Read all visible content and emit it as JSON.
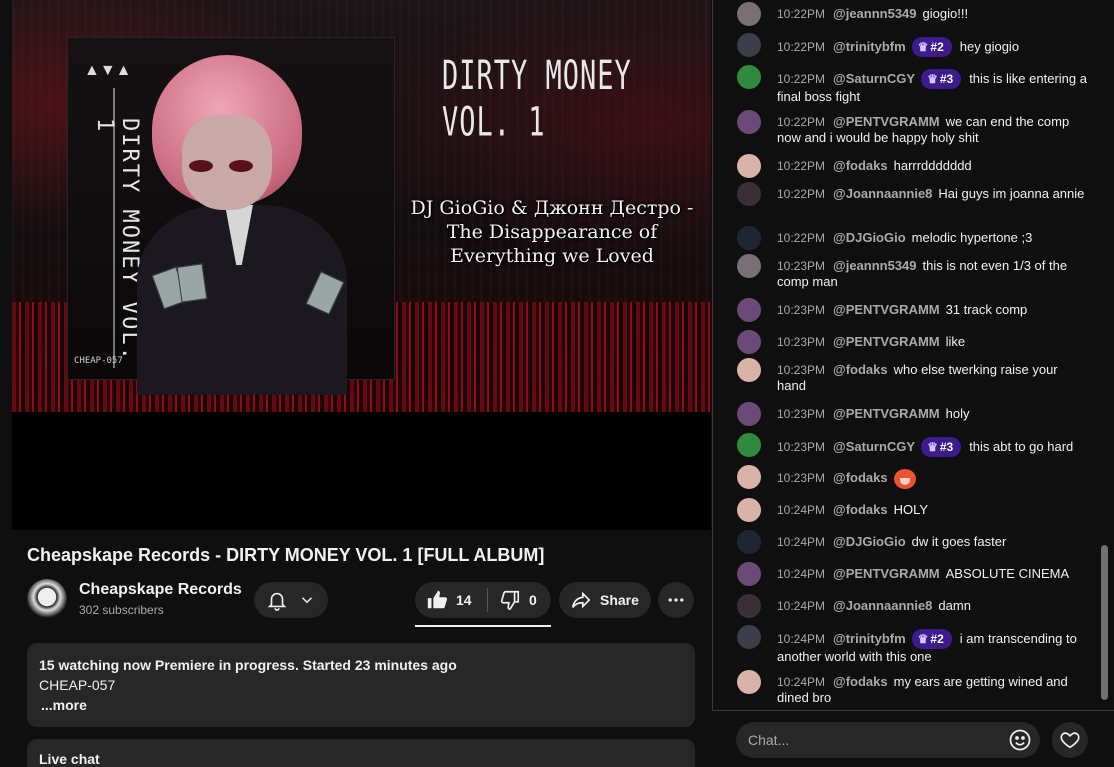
{
  "video": {
    "title": "Cheapskape Records - DIRTY MONEY VOL. 1 [FULL ALBUM]",
    "artwork": {
      "headline": "DIRTY MONEY VOL. 1",
      "cover_vertical": "DIRTY MONEY VOL. 1",
      "cover_catalog": "CHEAP-057",
      "credits_line1": "DJ GioGio & Джонн Дестро -",
      "credits_line2": "The Disappearance of",
      "credits_line3": "Everything we Loved"
    }
  },
  "channel": {
    "name": "Cheapskape Records",
    "subscribers": "302 subscribers"
  },
  "actions": {
    "likes": "14",
    "dislikes": "0",
    "share_label": "Share"
  },
  "description": {
    "stats": "15 watching now  Premiere in progress. Started 23 minutes ago",
    "line": "CHEAP-057",
    "more": "...more"
  },
  "live_chat_label": "Live chat",
  "chat": {
    "input_placeholder": "Chat...",
    "messages": [
      {
        "time": "10:22PM",
        "user": "@jeannn5349",
        "badge": "",
        "text": "giogio!!!",
        "avatar_color": "#7a6f76"
      },
      {
        "time": "10:22PM",
        "user": "@trinitybfm",
        "badge": "#2",
        "text": "hey giogio",
        "avatar_color": "#3b3f4a"
      },
      {
        "time": "10:22PM",
        "user": "@SaturnCGY",
        "badge": "#3",
        "text": "this is like entering a final boss fight",
        "avatar_color": "#2e8b3e"
      },
      {
        "time": "10:22PM",
        "user": "@PENTVGRAMM",
        "badge": "",
        "text": "we can end the comp now and i would be happy holy shit",
        "avatar_color": "#6b4a78"
      },
      {
        "time": "10:22PM",
        "user": "@fodaks",
        "badge": "",
        "text": "harrrddddddd",
        "avatar_color": "#d9b3a8"
      },
      {
        "time": "10:22PM",
        "user": "@Joannaannie8",
        "badge": "",
        "text": "Hai guys im joanna annie",
        "avatar_color": "#3a2f38"
      },
      {
        "time": "10:22PM",
        "user": "@DJGioGio",
        "badge": "",
        "text": "melodic hypertone ;3",
        "avatar_color": "#1f2733"
      },
      {
        "time": "10:23PM",
        "user": "@jeannn5349",
        "badge": "",
        "text": "this is not even 1/3 of the comp man",
        "avatar_color": "#7a6f76"
      },
      {
        "time": "10:23PM",
        "user": "@PENTVGRAMM",
        "badge": "",
        "text": "31 track comp",
        "avatar_color": "#6b4a78"
      },
      {
        "time": "10:23PM",
        "user": "@PENTVGRAMM",
        "badge": "",
        "text": "like",
        "avatar_color": "#6b4a78"
      },
      {
        "time": "10:23PM",
        "user": "@fodaks",
        "badge": "",
        "text": "who else twerking raise your hand",
        "avatar_color": "#d9b3a8"
      },
      {
        "time": "10:23PM",
        "user": "@PENTVGRAMM",
        "badge": "",
        "text": "holy",
        "avatar_color": "#6b4a78"
      },
      {
        "time": "10:23PM",
        "user": "@SaturnCGY",
        "badge": "#3",
        "text": "this abt to go hard",
        "avatar_color": "#2e8b3e"
      },
      {
        "time": "10:23PM",
        "user": "@fodaks",
        "badge": "",
        "text": "",
        "avatar_color": "#d9b3a8"
      },
      {
        "time": "10:24PM",
        "user": "@fodaks",
        "badge": "",
        "text": "HOLY",
        "avatar_color": "#d9b3a8"
      },
      {
        "time": "10:24PM",
        "user": "@DJGioGio",
        "badge": "",
        "text": "dw it goes faster",
        "avatar_color": "#1f2733"
      },
      {
        "time": "10:24PM",
        "user": "@PENTVGRAMM",
        "badge": "",
        "text": "ABSOLUTE CINEMA",
        "avatar_color": "#6b4a78"
      },
      {
        "time": "10:24PM",
        "user": "@Joannaannie8",
        "badge": "",
        "text": "damn",
        "avatar_color": "#3a2f38"
      },
      {
        "time": "10:24PM",
        "user": "@trinitybfm",
        "badge": "#2",
        "text": "i am transcending to another world with this one",
        "avatar_color": "#3b3f4a"
      },
      {
        "time": "10:24PM",
        "user": "@fodaks",
        "badge": "",
        "text": "my ears are getting wined and dined bro",
        "avatar_color": "#d9b3a8"
      }
    ]
  },
  "colors": {
    "background": "#0f0f0f",
    "surface": "#272727",
    "badge": "#3d1b8c",
    "text_secondary": "#aaaaaa"
  }
}
